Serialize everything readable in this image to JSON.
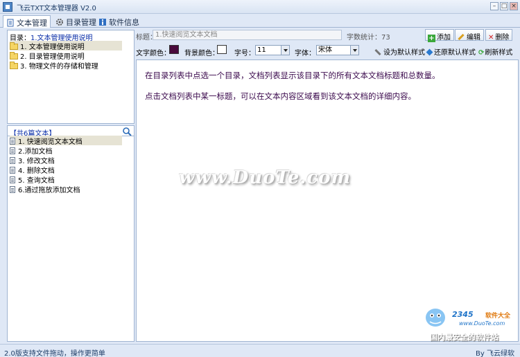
{
  "window": {
    "title": "飞云TXT文本管理器 V2.0",
    "minimize": "–",
    "maximize": "□",
    "close": "×"
  },
  "tabs": [
    {
      "label": "文本管理",
      "icon": "document-icon"
    },
    {
      "label": "目录管理",
      "icon": "gear-icon"
    },
    {
      "label": "软件信息",
      "icon": "info-icon"
    }
  ],
  "directory": {
    "head_prefix": "目录：",
    "head_current": "1.文本管理使用说明",
    "items": [
      "1. 文本管理使用说明",
      "2. 目录管理使用说明",
      "3. 物理文件的存储和管理"
    ]
  },
  "documents": {
    "count_label": "【共6篇文本】",
    "items": [
      "1. 快速阅览文本文档",
      "2.添加文档",
      "3. 修改文档",
      "4. 删除文档",
      "5. 查询文档",
      "6.通过拖放添加文档"
    ]
  },
  "editor": {
    "title_label": "标题：",
    "title_value": "1.快速阅览文本文档",
    "word_count_label": "字数统计：",
    "word_count": "73",
    "add_label": "添加",
    "edit_label": "编辑",
    "delete_label": "删除",
    "text_color_label": "文字颜色：",
    "text_color": "#4a0a3c",
    "bg_color_label": "背景颜色：",
    "bg_color": "#ffffff",
    "font_size_label": "字号：",
    "font_size": "11",
    "font_face_label": "字体：",
    "font_face": "宋体",
    "set_default_label": "设为默认样式",
    "restore_default_label": "还原默认样式",
    "refresh_label": "刷新样式"
  },
  "content": {
    "paragraphs": [
      "在目录列表中点选一个目录，文档列表显示该目录下的所有文本文档标题和总数量。",
      "点击文档列表中某一标题，可以在文本内容区域看到该文本文档的详细内容。"
    ]
  },
  "watermarks": {
    "duote": "www.DuoTe.com",
    "brand": "2345",
    "brand_suffix": "软件大全",
    "url": "www.DuoTe.com",
    "slogan": "国内最安全的软件站"
  },
  "status": {
    "left": "2.0版支持文件拖动，操作更简单",
    "right": "By 飞云绿软"
  },
  "colors": {
    "accent": "#1e73c8",
    "chrome": "#dfe8f6",
    "border": "#9fb4d1"
  }
}
